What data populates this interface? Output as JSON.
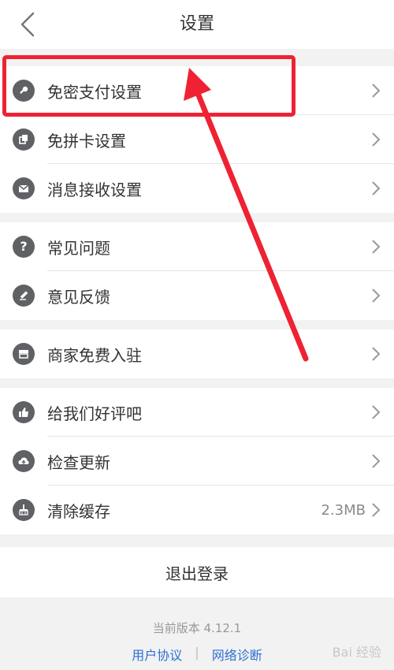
{
  "header": {
    "title": "设置",
    "back_icon": "chevron-left-icon"
  },
  "groups": [
    {
      "items": [
        {
          "label": "免密支付设置",
          "icon": "key-icon"
        },
        {
          "label": "免拼卡设置",
          "icon": "card-copy-icon"
        },
        {
          "label": "消息接收设置",
          "icon": "mail-icon"
        }
      ]
    },
    {
      "items": [
        {
          "label": "常见问题",
          "icon": "question-icon"
        },
        {
          "label": "意见反馈",
          "icon": "pencil-icon"
        }
      ]
    },
    {
      "items": [
        {
          "label": "商家免费入驻",
          "icon": "store-icon"
        }
      ]
    },
    {
      "items": [
        {
          "label": "给我们好评吧",
          "icon": "thumb-up-icon"
        },
        {
          "label": "检查更新",
          "icon": "upload-cloud-icon"
        },
        {
          "label": "清除缓存",
          "icon": "broom-icon",
          "value": "2.3MB"
        }
      ]
    }
  ],
  "logout": {
    "label": "退出登录"
  },
  "footer": {
    "version": "当前版本 4.12.1",
    "link_user_agreement": "用户协议",
    "link_separator": "|",
    "link_network_diagnosis": "网络诊断",
    "watermark": "Bai 经验"
  },
  "annotation": {
    "color": "#ee2233"
  }
}
